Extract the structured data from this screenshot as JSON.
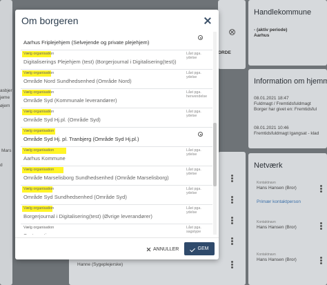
{
  "background": {
    "left_texts": [
      "asbjer",
      "jeme",
      "øjem",
      "Mars",
      "d"
    ],
    "mid_button_label": "ORDE",
    "handlekommune": {
      "title": "Handlekommune",
      "period": "- (aktiv periode)",
      "value": "Aarhus"
    },
    "info": {
      "title": "Information om hjemme",
      "items": [
        {
          "date": "08.01.2021 18:47",
          "text1": "Fuldmagt / Fremtidsfuldmagt",
          "text2": "Borger har givet en: Fremtidsful"
        },
        {
          "date": "08.01.2021 10:46",
          "text1": "Fremtidsfuldmagt lgangsat - klad",
          "text2": ""
        }
      ]
    },
    "netvaerk": {
      "title": "Netværk",
      "contacts": [
        {
          "label": "Kontaktnavn",
          "name": "Hans Hansen (Bror)",
          "link": "Primær kontaktperson"
        },
        {
          "label": "Kontaktnavn",
          "name": "Hans Hansen (Bror)",
          "link": ""
        },
        {
          "label": "Kontaktnavn",
          "name": "Hans Hansen (Bror)",
          "link": ""
        }
      ]
    },
    "bottom_text": "Hanne (Sygeplejerske)"
  },
  "modal": {
    "title": "Om borgeren",
    "entries": [
      {
        "label": "",
        "value": "Aarhus Friplejehjem (Selvejende og private plejehjem)",
        "status": "",
        "icon": true,
        "inactive": false
      },
      {
        "label": "Vælg organisation",
        "value": "Digitaliserings Plejehjem (test) (Borgerjournal i Digitalisering(test))",
        "status": "Låst pga. ydelse",
        "icon": false,
        "inactive": true
      },
      {
        "label": "Vælg organisation",
        "value": "Område Nord Sundhedsenhed (Område Nord)",
        "status": "Låst pga. ydelse",
        "icon": false,
        "inactive": true
      },
      {
        "label": "Vælg organisation",
        "value": "Område Syd (Kommunale leverandører)",
        "status": "Låst pga. henvendelse",
        "icon": false,
        "inactive": true
      },
      {
        "label": "Vælg organisation",
        "value": "Område Syd Hj.pl. (Område Syd)",
        "status": "Låst pga. ydelse",
        "icon": false,
        "inactive": true
      },
      {
        "label": "Vælg organisation",
        "value": "Område Syd Hj. pl. Tranbjerg (Område Syd Hj.pl.)",
        "status": "",
        "icon": true,
        "inactive": false
      },
      {
        "label": "Vælg organisation",
        "value": "Aarhus Kommune",
        "status": "Låst pga. ydelse",
        "icon": false,
        "inactive": true
      },
      {
        "label": "Vælg organisation",
        "value": "Område Marselisborg Sundhedsenhed (Område Marselisborg)",
        "status": "Låst pga. ydelse",
        "icon": false,
        "inactive": true
      },
      {
        "label": "Vælg organisation",
        "value": "Område Syd Sundhedsenhed (Område Syd)",
        "status": "Låst pga. ydelse",
        "icon": false,
        "inactive": true
      },
      {
        "label": "Vælg organisation",
        "value": "Borgerjournal i Digitalisering(test) (Øvrige leverandører)",
        "status": "Låst pga. ydelse",
        "icon": false,
        "inactive": true
      },
      {
        "label": "Vælg organisation",
        "value": "Systematic",
        "status": "Låst pga. sagstype",
        "icon": false,
        "inactive": true
      }
    ],
    "cancel_label": "ANNULLER",
    "save_label": "GEM"
  },
  "colors": {
    "overlay": "#6e7377",
    "primary_button": "#2f4a6b",
    "highlight": "#fff200",
    "link": "#3a6fa8"
  }
}
